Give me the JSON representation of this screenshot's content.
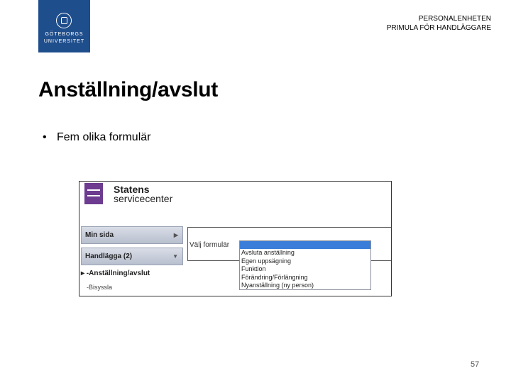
{
  "logo": {
    "line1": "GÖTEBORGS",
    "line2": "UNIVERSITET"
  },
  "header": {
    "line1": "PERSONALENHETEN",
    "line2": "PRIMULA FÖR HANDLÄGGARE"
  },
  "slide": {
    "title": "Anställning/avslut",
    "bullets": [
      "Fem olika formulär"
    ],
    "page_number": "57"
  },
  "screenshot": {
    "brand": {
      "line1": "Statens",
      "line2": "servicecenter"
    },
    "menu": {
      "item1": {
        "label": "Min sida",
        "icon": "arrow-right-icon"
      },
      "item2": {
        "label": "Handlägga (2)",
        "icon": "arrow-down-icon"
      },
      "active_sub": "Anställning/avslut",
      "sub2": "Bisyssla"
    },
    "form": {
      "label": "Välj formulär",
      "selected": "",
      "options": [
        "Avsluta anställning",
        "Egen uppsägning",
        "Funktion",
        "Förändring/Förlängning",
        "Nyanställning (ny person)"
      ]
    }
  }
}
